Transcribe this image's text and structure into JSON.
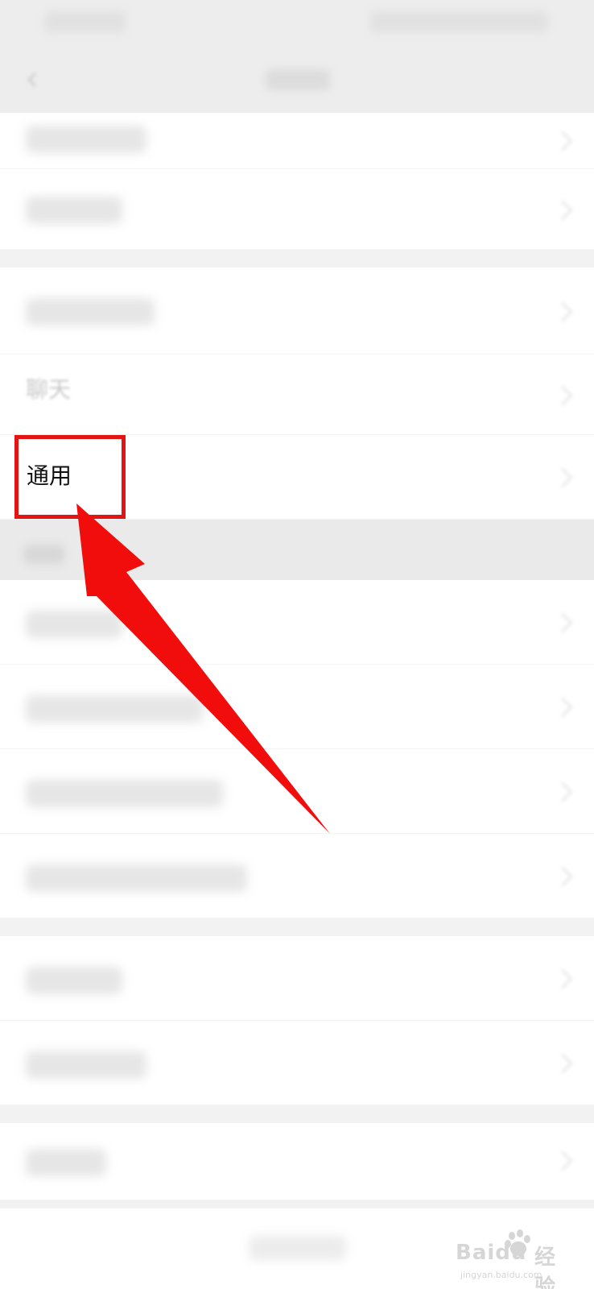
{
  "highlighted_item": {
    "label": "通用"
  },
  "partial_item": {
    "label": "聊天"
  },
  "watermark": {
    "brand": "Baidu",
    "product": "经验",
    "url": "jingyan.baidu.com"
  },
  "colors": {
    "highlight": "#e21515",
    "arrow": "#f20d0d",
    "background": "#ffffff",
    "separator": "#f2f2f2"
  },
  "icons": [
    "back-icon",
    "chevron-right-icon",
    "baidu-paw-icon"
  ]
}
